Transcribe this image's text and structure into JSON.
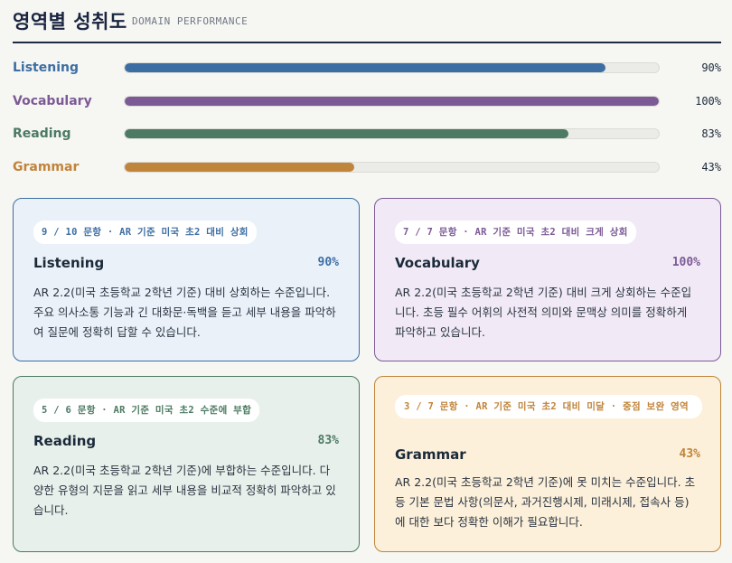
{
  "header": {
    "title": "영역별 성취도",
    "subtitle": "DOMAIN PERFORMANCE"
  },
  "colors": {
    "listening": "#3d6ea3",
    "vocabulary": "#7b5a95",
    "reading": "#4c7a63",
    "grammar": "#c0843a"
  },
  "domains": [
    {
      "name": "Listening",
      "percent_label": "90%",
      "percent": 90,
      "tag": "9 / 10 문항 · AR 기준 미국 초2 대비 상회",
      "description": "AR 2.2(미국 초등학교 2학년 기준) 대비 상회하는 수준입니다. 주요 의사소통 기능과 긴 대화문·독백을 듣고 세부 내용을 파악하여 질문에 정확히 답할 수 있습니다."
    },
    {
      "name": "Vocabulary",
      "percent_label": "100%",
      "percent": 100,
      "tag": "7 / 7 문항 · AR 기준 미국 초2 대비 크게 상회",
      "description": "AR 2.2(미국 초등학교 2학년 기준) 대비 크게 상회하는 수준입니다. 초등 필수 어휘의 사전적 의미와 문맥상 의미를 정확하게 파악하고 있습니다."
    },
    {
      "name": "Reading",
      "percent_label": "83%",
      "percent": 83,
      "tag": "5 / 6 문항 · AR 기준 미국 초2 수준에 부합",
      "description": "AR 2.2(미국 초등학교 2학년 기준)에 부합하는 수준입니다. 다양한 유형의 지문을 읽고 세부 내용을 비교적 정확히 파악하고 있습니다."
    },
    {
      "name": "Grammar",
      "percent_label": "43%",
      "percent": 43,
      "tag": "3 / 7 문항 · AR 기준 미국 초2 대비 미달 · 중점 보완 영역",
      "description": "AR 2.2(미국 초등학교 2학년 기준)에 못 미치는 수준입니다. 초등 기본 문법 사항(의문사, 과거진행시제, 미래시제, 접속사 등)에 대한 보다 정확한 이해가 필요합니다."
    }
  ]
}
